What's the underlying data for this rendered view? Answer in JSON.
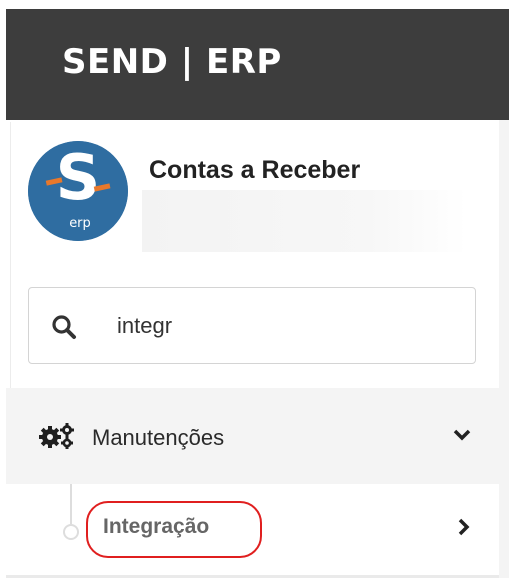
{
  "header": {
    "brand": "SEND | ERP"
  },
  "profile": {
    "logo_text": "S",
    "logo_caption": "erp",
    "title": "Contas a Receber"
  },
  "search": {
    "value": "integr",
    "icon": "search-icon"
  },
  "menu": {
    "section_label": "Manutenções",
    "section_icon": "cogs-icon",
    "section_expanded": true,
    "sub_items": [
      {
        "label": "Integração",
        "highlighted": true
      }
    ]
  },
  "colors": {
    "header_bg": "#3d3d3d",
    "logo_blue": "#2f6da1",
    "logo_orange": "#e8782b",
    "highlight_red": "#e01f1f",
    "menu_bg": "#f4f4f4"
  }
}
